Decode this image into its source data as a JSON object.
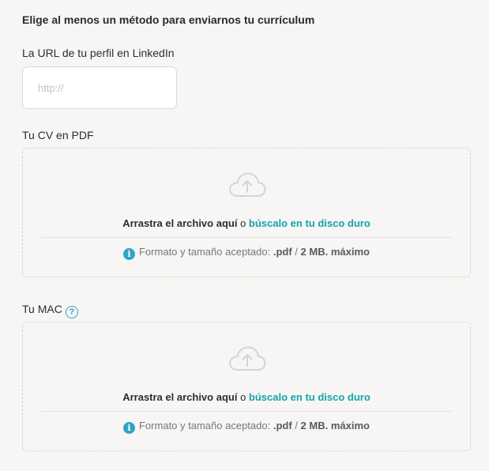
{
  "form": {
    "heading": "Elige al menos un método para enviarnos tu currículum",
    "linkedin": {
      "label": "La URL de tu perfil en LinkedIn",
      "placeholder": "http://",
      "value": ""
    },
    "cv": {
      "label": "Tu CV en PDF",
      "drop_text": "Arrastra el archivo aquí",
      "or": "o",
      "browse_link": "búscalo en tu disco duro",
      "info_prefix": "Formato y tamaño aceptado:",
      "info_format": ".pdf",
      "info_sep": "/",
      "info_size": "2 MB. máximo"
    },
    "mac": {
      "label": "Tu MAC",
      "help_glyph": "?",
      "drop_text": "Arrastra el archivo aquí",
      "or": "o",
      "browse_link": "búscalo en tu disco duro",
      "info_prefix": "Formato y tamaño aceptado:",
      "info_format": ".pdf",
      "info_sep": "/",
      "info_size": "2 MB. máximo"
    }
  },
  "icons": {
    "cloud": "cloud-upload-icon",
    "info": "info-icon",
    "info_glyph": "i",
    "help": "help-icon"
  },
  "colors": {
    "accent": "#15a2ac",
    "info_icon": "#2ea4c6",
    "background": "#f7f6f4"
  }
}
